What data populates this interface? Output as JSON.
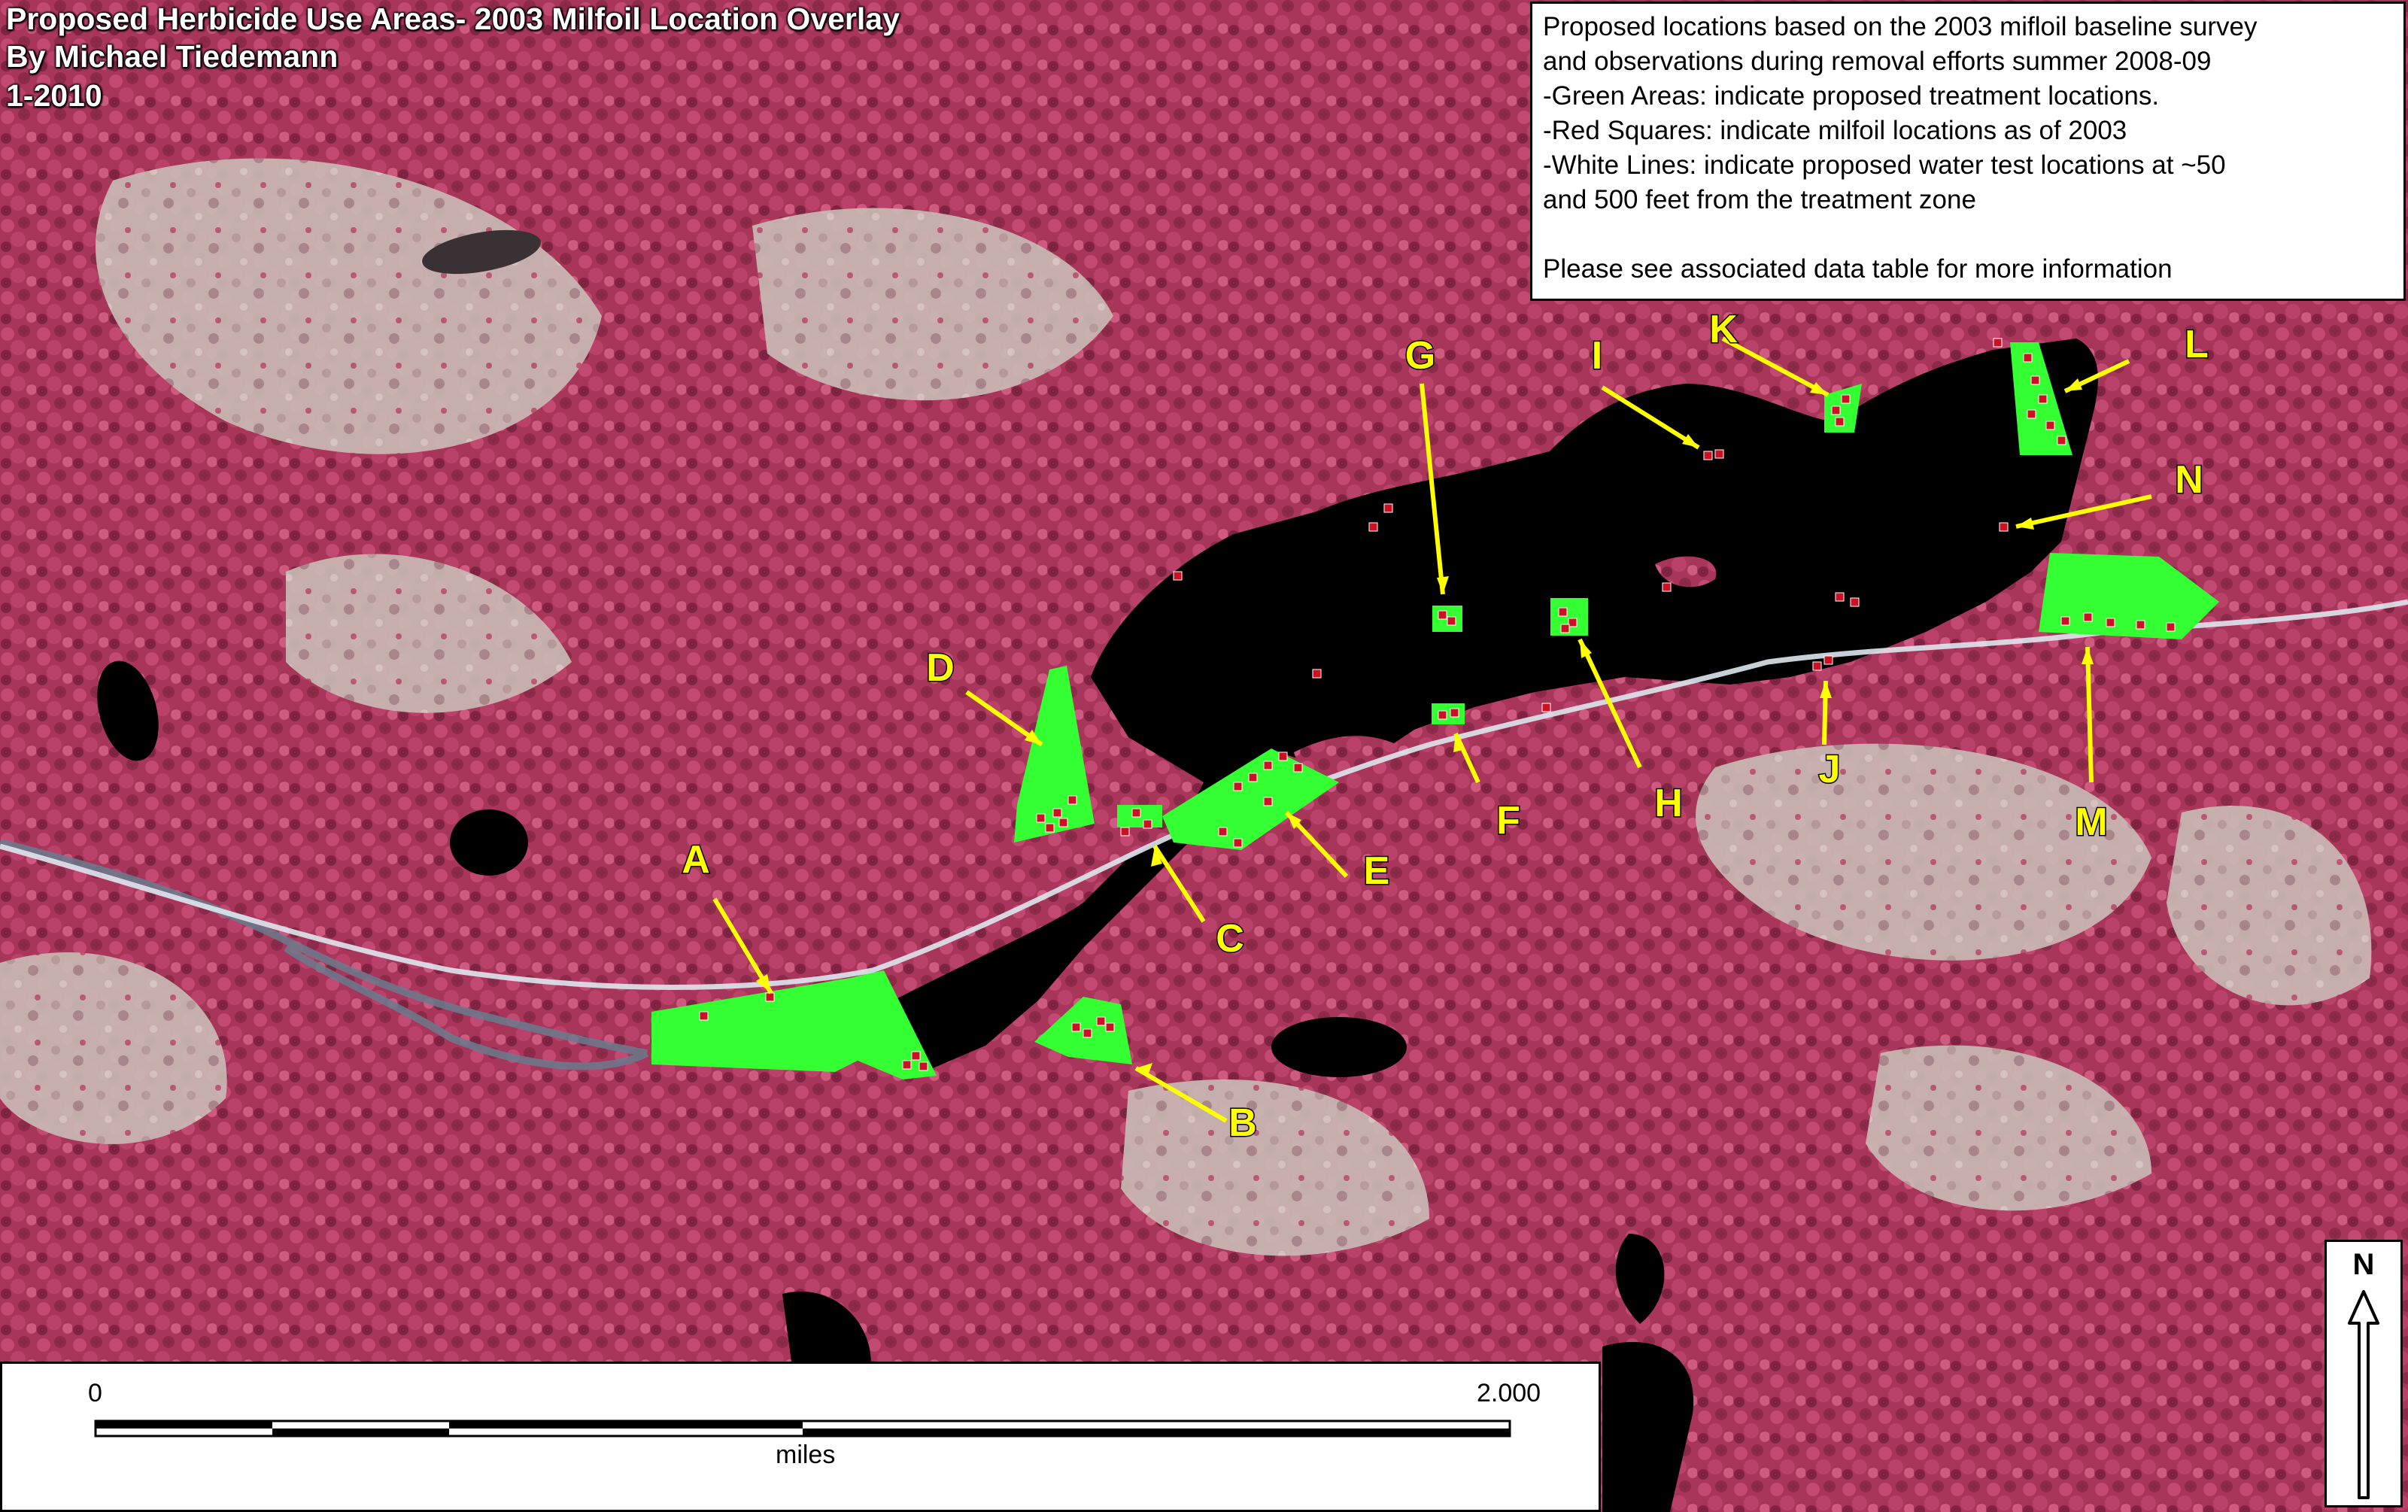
{
  "title": {
    "line1": "Proposed Herbicide Use Areas- 2003 Milfoil Location Overlay",
    "line2": "By Michael Tiedemann",
    "line3": "1-2010"
  },
  "legend": {
    "lines": [
      "Proposed locations based on the 2003 mifloil baseline survey",
      "and observations during removal efforts summer 2008-09",
      "-Green Areas: indicate proposed treatment locations.",
      "-Red Squares: indicate milfoil locations as of 2003",
      "-White Lines: indicate proposed water test locations at ~50",
      "and 500 feet from the treatment zone",
      "",
      "Please see associated data table for more information"
    ]
  },
  "scale_bar": {
    "start_label": "0",
    "end_label": "2.000",
    "unit_label": "miles"
  },
  "north_arrow": {
    "label": "N"
  },
  "site_labels": [
    "A",
    "B",
    "C",
    "D",
    "E",
    "F",
    "G",
    "H",
    "I",
    "J",
    "K",
    "L",
    "M",
    "N"
  ],
  "colors": {
    "treatment_area": "#33ff33",
    "milfoil_marker": "#cc1122",
    "callout": "#ffff00",
    "water": "#000000",
    "forest": "#b03a5e",
    "clearing": "#cbbcb6",
    "test_line": "#dde6ee"
  }
}
